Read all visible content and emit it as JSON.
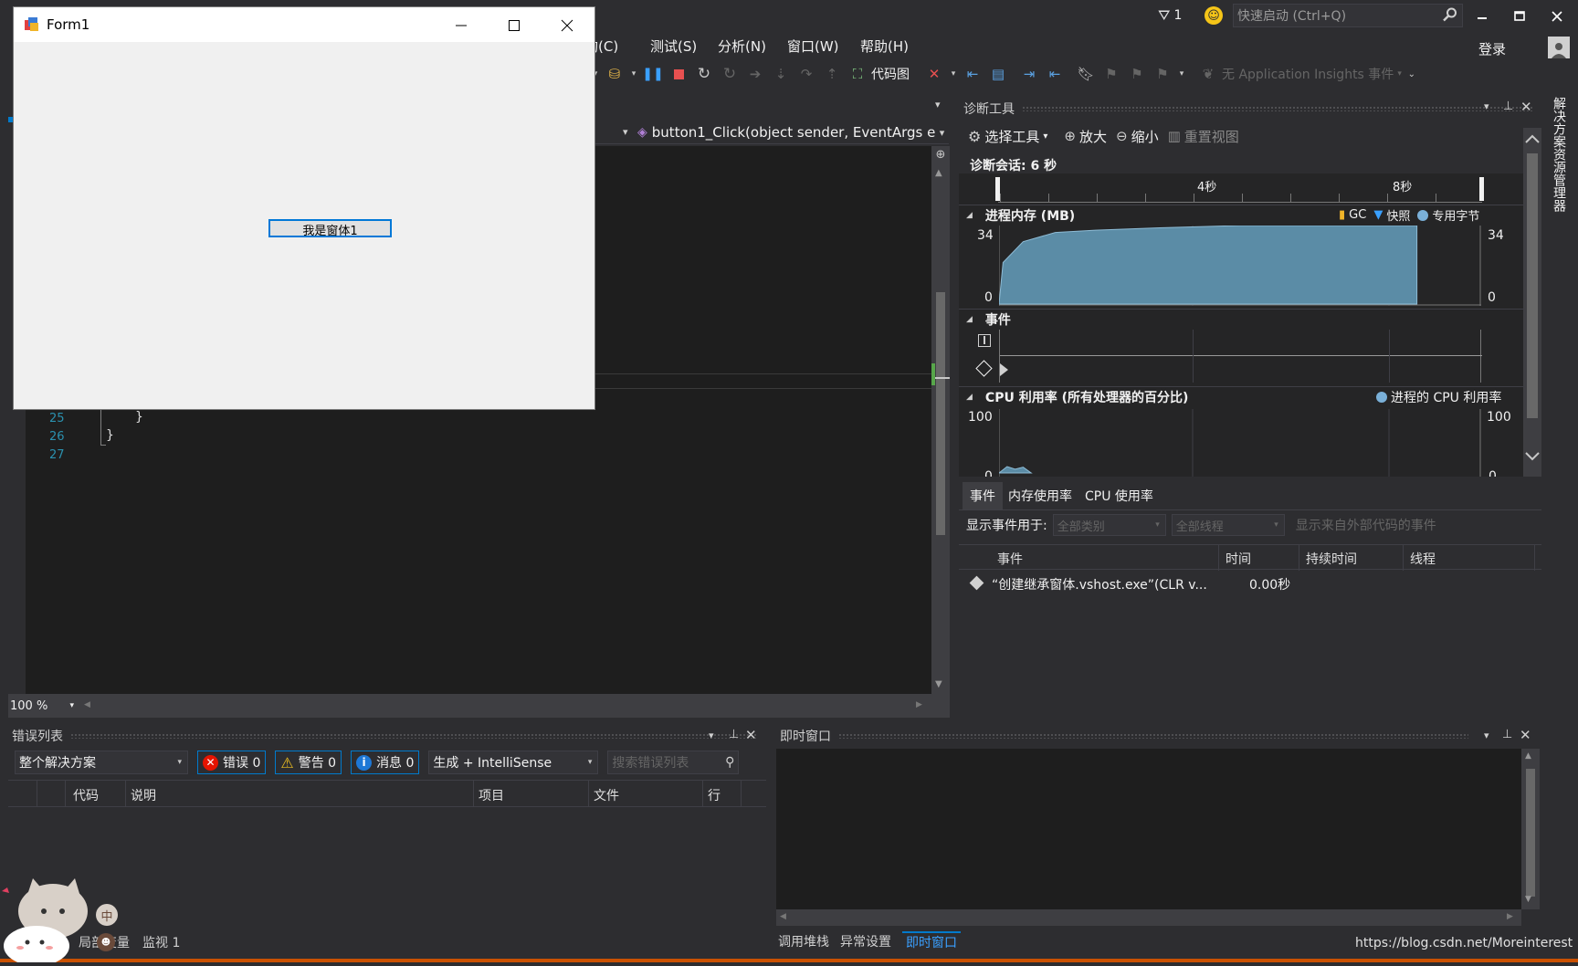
{
  "menu": {
    "items": [
      "构(C)",
      "测试(S)",
      "分析(N)",
      "窗口(W)",
      "帮助(H)"
    ],
    "login": "登录",
    "notification_count": "1",
    "quick_launch_placeholder": "快速启动 (Ctrl+Q)"
  },
  "toolbar": {
    "code_map": "代码图",
    "app_insights": "无 Application Insights 事件"
  },
  "editor": {
    "method_dropdown": "button1_Click(object sender, EventArgs e",
    "line_numbers": [
      "25",
      "26",
      "27"
    ],
    "lines": [
      "}",
      "}",
      ""
    ],
    "zoom": "100 %"
  },
  "form_window": {
    "title": "Form1",
    "button_label": "我是窗体1"
  },
  "diagnostics": {
    "title": "诊断工具",
    "select_tools": "选择工具",
    "zoom_in": "放大",
    "zoom_out": "缩小",
    "reset_view": "重置视图",
    "session": "诊断会话: 6 秒",
    "timeline_ticks": [
      "4秒",
      "8秒"
    ],
    "memory": {
      "title": "进程内存 (MB)",
      "legend": [
        "GC",
        "快照",
        "专用字节"
      ],
      "y_max": "34",
      "y_min": "0"
    },
    "events_title": "事件",
    "cpu": {
      "title": "CPU 利用率 (所有处理器的百分比)",
      "legend": "进程的 CPU 利用率",
      "y_max": "100",
      "y_min": "0"
    },
    "tabs": [
      "事件",
      "内存使用率",
      "CPU 使用率"
    ],
    "filter_label": "显示事件用于:",
    "filter_category": "全部类别",
    "filter_thread": "全部线程",
    "filter_external": "显示来自外部代码的事件",
    "columns": [
      "事件",
      "时间",
      "持续时间",
      "线程"
    ],
    "rows": [
      {
        "event": "“创建继承窗体.vshost.exe”(CLR v...",
        "time": "0.00秒",
        "duration": "",
        "thread": ""
      }
    ]
  },
  "error_list": {
    "title": "错误列表",
    "scope": "整个解决方案",
    "errors": "错误 0",
    "warnings": "警告 0",
    "messages": "消息 0",
    "build_filter": "生成 + IntelliSense",
    "search_placeholder": "搜索错误列表",
    "columns": [
      "代码",
      "说明",
      "项目",
      "文件",
      "行"
    ]
  },
  "immediate": {
    "title": "即时窗口"
  },
  "bottom_tabs_left": [
    "局部变量",
    "监视 1"
  ],
  "bottom_tabs_right": [
    "调用堆栈",
    "异常设置",
    "即时窗口"
  ],
  "side_tab": "解决方案资源管理器",
  "watermark": "https://blog.csdn.net/Moreinterest",
  "ime_label": "中",
  "chart_data": [
    {
      "type": "area",
      "title": "进程内存 (MB)",
      "x_unit": "秒",
      "x": [
        0,
        0.05,
        0.3,
        0.7,
        1.2,
        2.0,
        3.0,
        4.0,
        5.0,
        5.2
      ],
      "y": [
        0,
        18,
        27,
        31,
        32,
        33,
        34,
        34,
        34,
        34
      ],
      "ylim": [
        0,
        34
      ],
      "xlim": [
        0,
        6
      ]
    },
    {
      "type": "area",
      "title": "CPU 利用率 (所有处理器的百分比)",
      "x_unit": "秒",
      "x": [
        0,
        0.1,
        0.2,
        0.3,
        0.4
      ],
      "y": [
        0,
        10,
        6,
        9,
        0
      ],
      "ylim": [
        0,
        100
      ],
      "xlim": [
        0,
        6
      ]
    }
  ]
}
